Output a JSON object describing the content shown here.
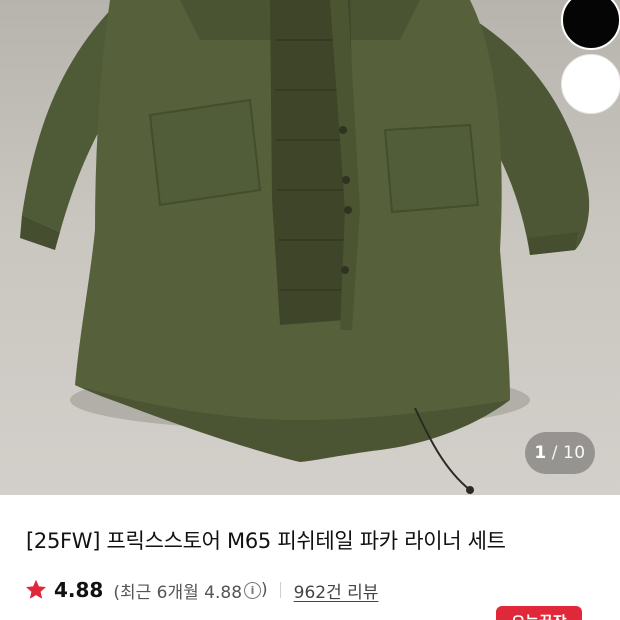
{
  "product": {
    "image_counter": {
      "current": "1",
      "separator": "/",
      "total": "10"
    },
    "color_options": [
      {
        "name": "black",
        "color": "#050505"
      },
      {
        "name": "white",
        "color": "#ffffff"
      }
    ],
    "title": "[25FW] 프릭스스토어 M65 피쉬테일 파카 라이너 세트",
    "rating": {
      "value": "4.88",
      "recent_text": "(최근 6개월 4.88",
      "recent_close": ")",
      "star_color": "#e0283a"
    },
    "reviews": {
      "label": "962건 리뷰"
    },
    "badge": {
      "label": "오늘끝장"
    }
  },
  "icons": [
    "star-icon",
    "info-icon",
    "parka-photo"
  ]
}
